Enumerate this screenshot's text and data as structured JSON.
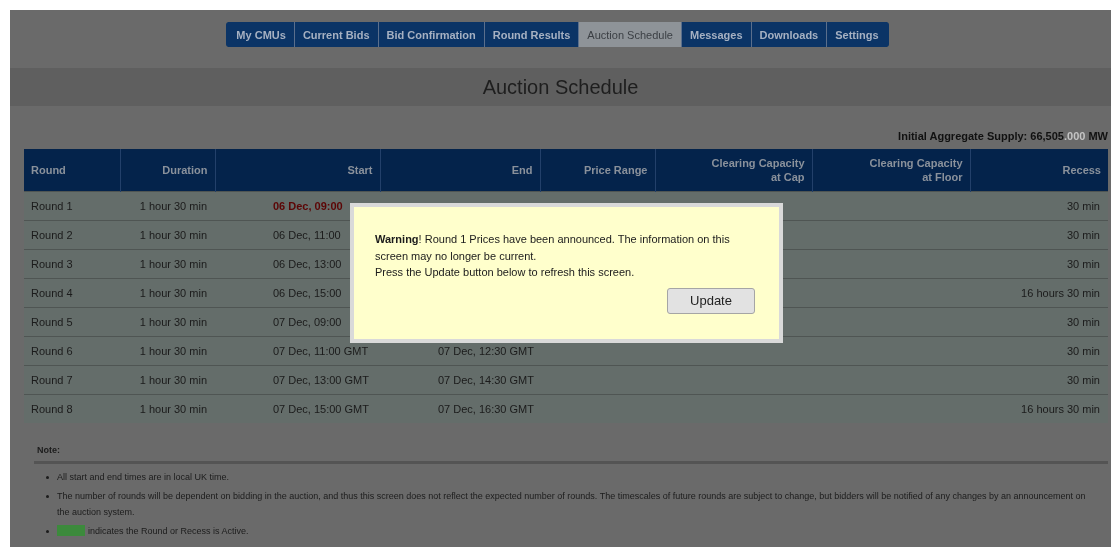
{
  "nav": {
    "tabs": [
      {
        "label": "My CMUs",
        "selected": false
      },
      {
        "label": "Current Bids",
        "selected": false
      },
      {
        "label": "Bid Confirmation",
        "selected": false
      },
      {
        "label": "Round Results",
        "selected": false
      },
      {
        "label": "Auction Schedule",
        "selected": true
      },
      {
        "label": "Messages",
        "selected": false
      },
      {
        "label": "Downloads",
        "selected": false
      },
      {
        "label": "Settings",
        "selected": false
      }
    ]
  },
  "page_title": "Auction Schedule",
  "supply": {
    "label": "Initial Aggregate Supply:",
    "value": "66,505",
    "decimals": ".000",
    "unit": "MW"
  },
  "table": {
    "columns": [
      "Round",
      "Duration",
      "Start",
      "End",
      "Price Range",
      "Clearing Capacity at Cap",
      "Clearing Capacity at Floor",
      "Recess"
    ],
    "rows": [
      {
        "current": true,
        "cells": [
          "Round 1",
          "1 hour 30 min",
          "06 Dec, 09:00",
          "",
          "",
          "",
          "",
          "30 min"
        ]
      },
      {
        "current": false,
        "cells": [
          "Round 2",
          "1 hour 30 min",
          "06 Dec, 11:00",
          "",
          "",
          "",
          "",
          "30 min"
        ]
      },
      {
        "current": false,
        "cells": [
          "Round 3",
          "1 hour 30 min",
          "06 Dec, 13:00",
          "",
          "",
          "",
          "",
          "30 min"
        ]
      },
      {
        "current": false,
        "cells": [
          "Round 4",
          "1 hour 30 min",
          "06 Dec, 15:00",
          "",
          "",
          "",
          "",
          "16 hours 30 min"
        ]
      },
      {
        "current": false,
        "cells": [
          "Round 5",
          "1 hour 30 min",
          "07 Dec, 09:00",
          "",
          "",
          "",
          "",
          "30 min"
        ]
      },
      {
        "current": false,
        "cells": [
          "Round 6",
          "1 hour 30 min",
          "07 Dec, 11:00 GMT",
          "07 Dec, 12:30 GMT",
          "",
          "",
          "",
          "30 min"
        ]
      },
      {
        "current": false,
        "cells": [
          "Round 7",
          "1 hour 30 min",
          "07 Dec, 13:00 GMT",
          "07 Dec, 14:30 GMT",
          "",
          "",
          "",
          "30 min"
        ]
      },
      {
        "current": false,
        "cells": [
          "Round 8",
          "1 hour 30 min",
          "07 Dec, 15:00 GMT",
          "07 Dec, 16:30 GMT",
          "",
          "",
          "",
          "16 hours 30 min"
        ]
      }
    ]
  },
  "notes": {
    "title": "Note:",
    "items": [
      {
        "kind": "text",
        "text": "All start and end times are in local UK time."
      },
      {
        "kind": "text",
        "text": "The number of rounds will be dependent on bidding in the auction, and thus this screen does not reflect the expected number of rounds. The timescales of future rounds are subject to change, but bidders will be notified of any changes by an announcement on the auction system."
      },
      {
        "kind": "legend",
        "color": "#3c8a3c",
        "text": "indicates the Round or Recess is Active."
      }
    ]
  },
  "dialog": {
    "message": "**Warning**! Round 1 Prices have been announced. The information on this screen may no longer be current.",
    "instruction": "Press the Update button below to refresh this screen.",
    "button": "Update"
  }
}
